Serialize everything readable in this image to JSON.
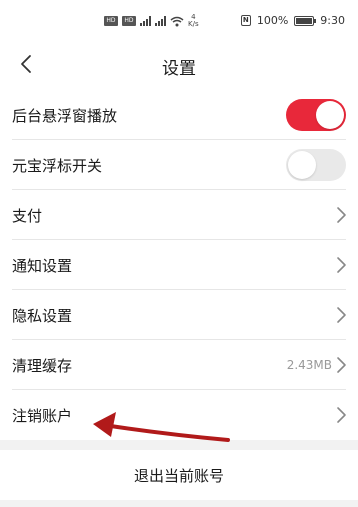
{
  "status_bar": {
    "sim1": "HD",
    "sim2": "HD",
    "speed_value": "4",
    "speed_unit": "K/s",
    "battery": "100%",
    "time": "9:30"
  },
  "header": {
    "title": "设置"
  },
  "settings": [
    {
      "label": "后台悬浮窗播放",
      "control": "toggle",
      "toggle_on": true
    },
    {
      "label": "元宝浮标开关",
      "control": "toggle",
      "toggle_on": false
    },
    {
      "label": "支付",
      "control": "chevron"
    },
    {
      "label": "通知设置",
      "control": "chevron"
    },
    {
      "label": "隐私设置",
      "control": "chevron"
    },
    {
      "label": "清理缓存",
      "control": "chevron",
      "value": "2.43MB"
    },
    {
      "label": "注销账户",
      "control": "chevron"
    }
  ],
  "logout_label": "退出当前账号",
  "colors": {
    "accent": "#e8283a",
    "arrow": "#b11a1a"
  }
}
